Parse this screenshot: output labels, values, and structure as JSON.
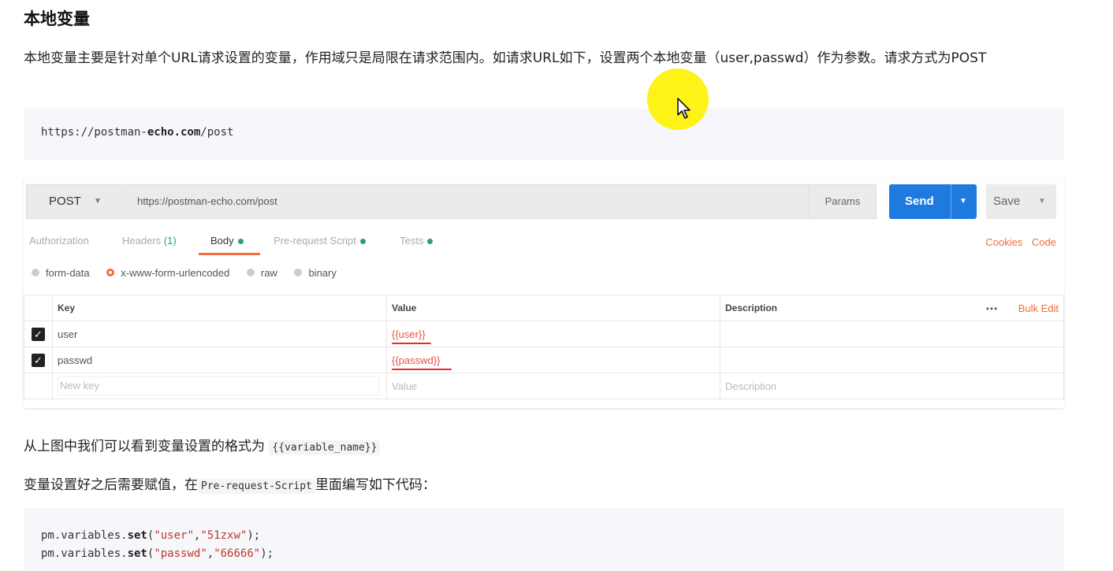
{
  "page": {
    "title": "本地变量",
    "intro": "本地变量主要是针对单个URL请求设置的变量，作用域只是局限在请求范围内。如请求URL如下，设置两个本地变量（user,passwd）作为参数。请求方式为POST",
    "url_code": {
      "prefix": "https://postman-",
      "bold": "echo.com",
      "suffix": "/post"
    }
  },
  "postman": {
    "method": "POST",
    "url": "https://postman-echo.com/post",
    "params_label": "Params",
    "send_label": "Send",
    "save_label": "Save",
    "tabs": [
      {
        "label": "Authorization"
      },
      {
        "label": "Headers",
        "count": "(1)"
      },
      {
        "label": "Body"
      },
      {
        "label": "Pre-request Script"
      },
      {
        "label": "Tests"
      }
    ],
    "links": {
      "cookies": "Cookies",
      "code": "Code"
    },
    "body_types": [
      {
        "label": "form-data",
        "selected": false
      },
      {
        "label": "x-www-form-urlencoded",
        "selected": true
      },
      {
        "label": "raw",
        "selected": false
      },
      {
        "label": "binary",
        "selected": false
      }
    ],
    "table": {
      "headers": {
        "key": "Key",
        "value": "Value",
        "description": "Description",
        "more": "•••",
        "bulk_edit": "Bulk Edit"
      },
      "rows": [
        {
          "checked": true,
          "key": "user",
          "value": "{{user}}",
          "description": ""
        },
        {
          "checked": true,
          "key": "passwd",
          "value": "{{passwd}}",
          "description": ""
        }
      ],
      "new_row": {
        "key_placeholder": "New key",
        "value_placeholder": "Value",
        "description_placeholder": "Description"
      }
    },
    "colors": {
      "send": "#1f7ae0",
      "accent": "#f26b3a",
      "variable": "#e8514a",
      "status_dot": "#30a06a"
    }
  },
  "para1": {
    "text": "从上图中我们可以看到变量设置的格式为",
    "code": "{{variable_name}}"
  },
  "para2": {
    "text_before": "变量设置好之后需要赋值，在",
    "code": "Pre-request-Script",
    "text_after": "里面编写如下代码："
  },
  "script": {
    "line1": {
      "obj": "pm.variables.",
      "fn": "set",
      "open": "(",
      "arg1": "\"user\"",
      "comma": ",",
      "arg2": "\"51zxw\"",
      "close": ");"
    },
    "line2": {
      "obj": "pm.variables.",
      "fn": "set",
      "open": "(",
      "arg1": "\"passwd\"",
      "comma": ",",
      "arg2": "\"66666\"",
      "close": ");"
    }
  },
  "icons": {
    "cursor": "mouse-pointer-icon",
    "checkbox": "checkmark-icon",
    "caret": "chevron-down-icon"
  }
}
